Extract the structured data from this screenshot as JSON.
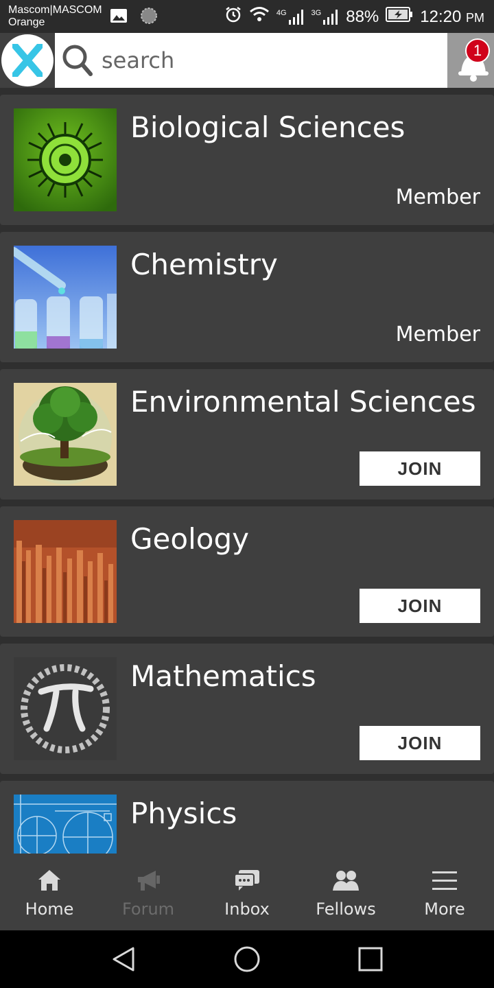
{
  "status_bar": {
    "carrier_line1": "Mascom|MASCOM",
    "carrier_line2": "Orange",
    "network_4g": "4G",
    "network_3g": "3G",
    "battery": "88%",
    "time": "12:20",
    "ampm": "PM",
    "icons": [
      "image-icon",
      "circle-status-icon",
      "alarm-icon",
      "wifi-icon",
      "signal-icon",
      "battery-charging-icon"
    ]
  },
  "header": {
    "logo_letter": "X",
    "search": {
      "placeholder": "search",
      "value": ""
    },
    "notification_count": "1"
  },
  "groups": [
    {
      "title": "Biological Sciences",
      "status": "Member",
      "thumbnail": "virus-image"
    },
    {
      "title": "Chemistry",
      "status": "Member",
      "thumbnail": "test-tubes-image"
    },
    {
      "title": "Environmental Sciences",
      "action": "JOIN",
      "thumbnail": "tree-globe-image"
    },
    {
      "title": "Geology",
      "action": "JOIN",
      "thumbnail": "canyon-image"
    },
    {
      "title": "Mathematics",
      "action": "JOIN",
      "thumbnail": "pi-chalkboard-image"
    },
    {
      "title": "Physics",
      "thumbnail": "physics-diagram-image"
    }
  ],
  "bottom_nav": [
    {
      "label": "Home",
      "icon": "home-icon"
    },
    {
      "label": "Forum",
      "icon": "megaphone-icon"
    },
    {
      "label": "Inbox",
      "icon": "chat-icon"
    },
    {
      "label": "Fellows",
      "icon": "people-icon"
    },
    {
      "label": "More",
      "icon": "menu-icon"
    }
  ],
  "colors": {
    "background": "#2f2f2f",
    "card": "#3f3f3f",
    "logo_accent": "#37c5e6",
    "badge": "#d0021b",
    "nav_inactive": "#6c6c6c"
  }
}
